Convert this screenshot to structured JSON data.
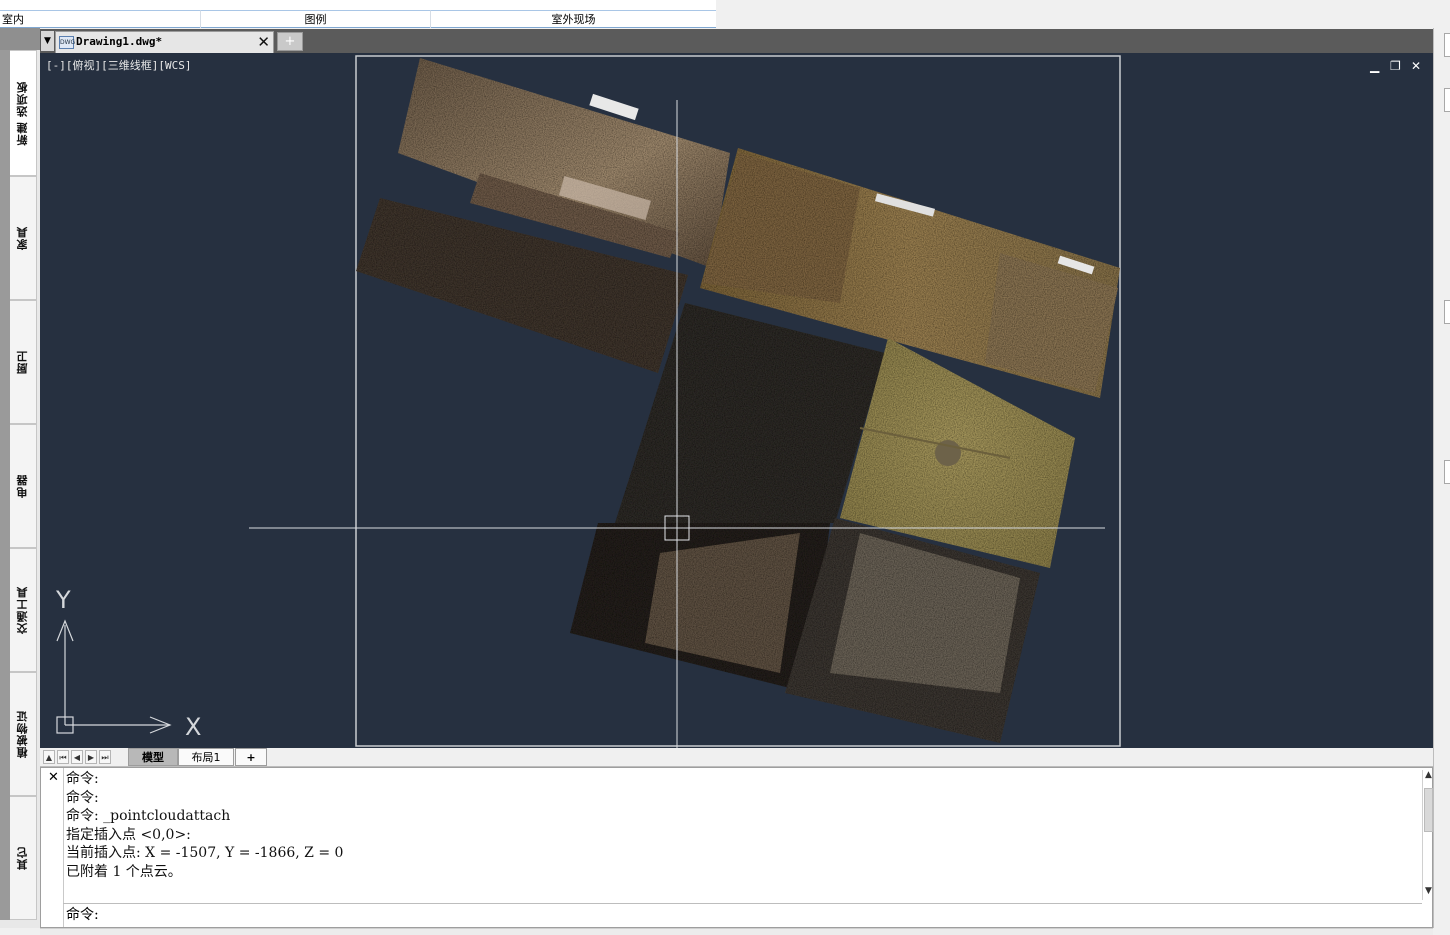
{
  "top_categories": [
    "室内",
    "图例",
    "室外现场"
  ],
  "palette_tabs": [
    {
      "label": "新建 选项板",
      "active": true
    },
    {
      "label": "家具",
      "active": false
    },
    {
      "label": "厨卫",
      "active": false
    },
    {
      "label": "电器",
      "active": false
    },
    {
      "label": "交通工具",
      "active": false
    },
    {
      "label": "植被物证",
      "active": false
    },
    {
      "label": "其它",
      "active": false
    }
  ],
  "document_tab": {
    "name": "Drawing1.dwg*",
    "icon": "dwg-file-icon",
    "close": "✕",
    "new_tab": "+"
  },
  "viewport": {
    "label": "[-][俯视][三维线框][WCS]",
    "controls": {
      "minimize": "▁",
      "restore": "❐",
      "close": "✕"
    },
    "ucs": {
      "x_label": "X",
      "y_label": "Y"
    },
    "background": "#263040"
  },
  "layout_tabs": {
    "nav": [
      "▲",
      "⏮",
      "◀",
      "▶",
      "⏭"
    ],
    "model": "模型",
    "layout1": "布局1",
    "plus": "+"
  },
  "command_window": {
    "close": "✕",
    "history": [
      "命令:",
      "命令:",
      "命令: _pointcloudattach",
      "指定插入点 <0,0>:",
      "当前插入点: X = -1507, Y = -1866, Z = 0",
      "已附着 1 个点云。"
    ],
    "prompt": "命令:"
  }
}
